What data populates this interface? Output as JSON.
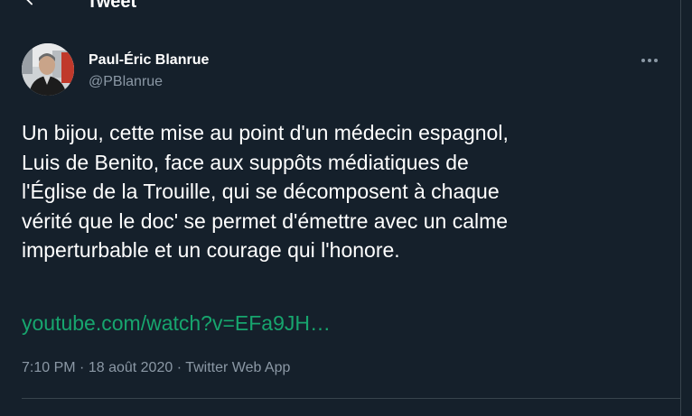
{
  "header": {
    "title": "Tweet",
    "back_icon": "arrow-left-icon"
  },
  "author": {
    "name": "Paul-Éric Blanrue",
    "handle": "@PBlanrue",
    "avatar_icon": "user-avatar"
  },
  "more_icon": "more-horizontal-icon",
  "tweet": {
    "lines": [
      "Un bijou, cette mise au point d'un médecin espagnol,",
      "Luis de Benito, face aux suppôts médiatiques de",
      "l'Église de la Trouille, qui se décomposent à chaque",
      "vérité que le doc' se permet d'émettre avec un calme",
      "imperturbable et un courage qui l'honore."
    ],
    "link": "youtube.com/watch?v=EFa9JH…"
  },
  "meta": {
    "time": "7:10 PM",
    "separator": "·",
    "date": "18 août 2020",
    "source": "Twitter Web App"
  },
  "colors": {
    "background": "#15202b",
    "link": "#17a56e",
    "secondary_text": "#8b98a5",
    "border": "#38444d"
  }
}
